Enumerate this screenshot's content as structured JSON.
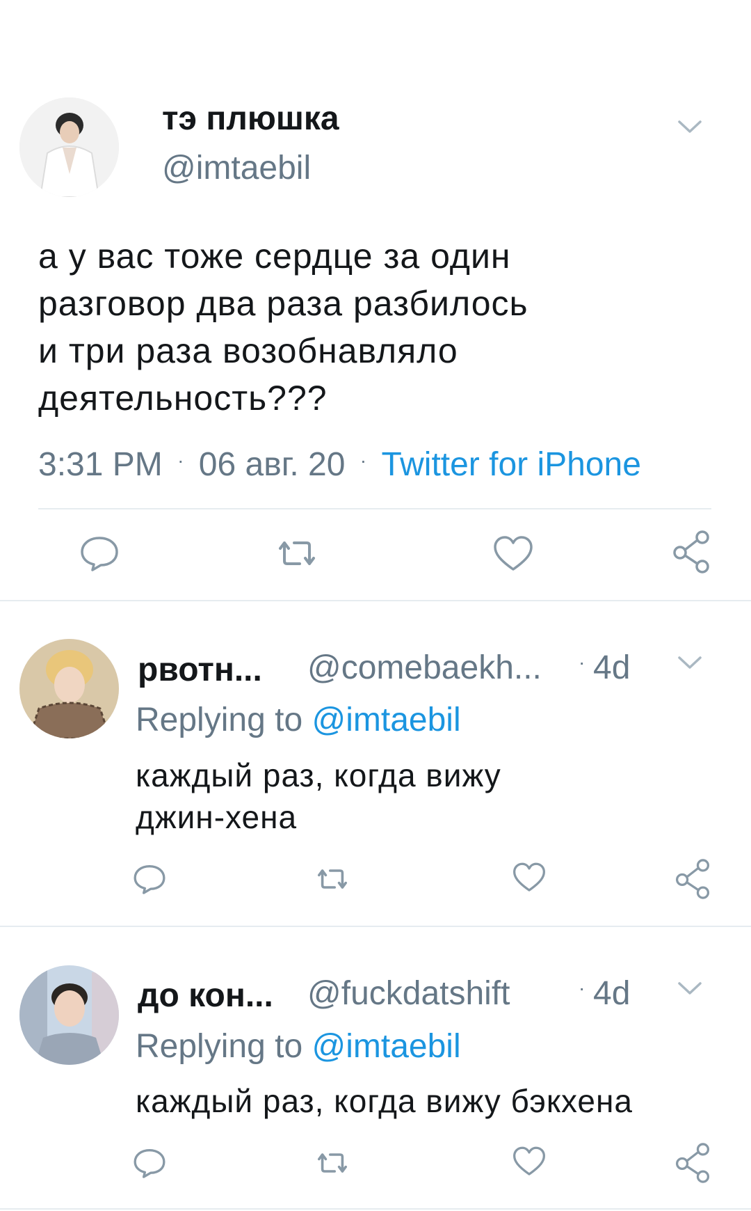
{
  "main_tweet": {
    "display_name": "тэ плюшка",
    "handle": "@imtaebil",
    "text_lines": [
      "а у вас тоже сердце за один",
      "разговор два раза разбилось",
      "и три раза возобнавляло",
      "деятельность???"
    ],
    "time": "3:31 PM",
    "date": "06 авг. 20",
    "dot": "·",
    "source": "Twitter for iPhone",
    "actions": [
      "reply-icon",
      "retweet-icon",
      "like-icon",
      "share-icon"
    ]
  },
  "replies": [
    {
      "display_name": "рвотн...",
      "handle": "@comebaekh...",
      "dot": "·",
      "age": "4d",
      "replying_prefix": "Replying to",
      "replying_handle": "@imtaebil",
      "text_lines": [
        "каждый раз, когда вижу",
        "джин-хена"
      ]
    },
    {
      "display_name": "до кон...",
      "handle": "@fuckdatshift",
      "dot": "·",
      "age": "4d",
      "replying_prefix": "Replying to",
      "replying_handle": "@imtaebil",
      "text_lines": [
        "каждый раз, когда вижу бэкхена"
      ]
    }
  ],
  "colors": {
    "text": "#14171a",
    "muted": "#657786",
    "link": "#1b95e0",
    "icon": "#8899a6",
    "separator": "#e6ecf0"
  }
}
